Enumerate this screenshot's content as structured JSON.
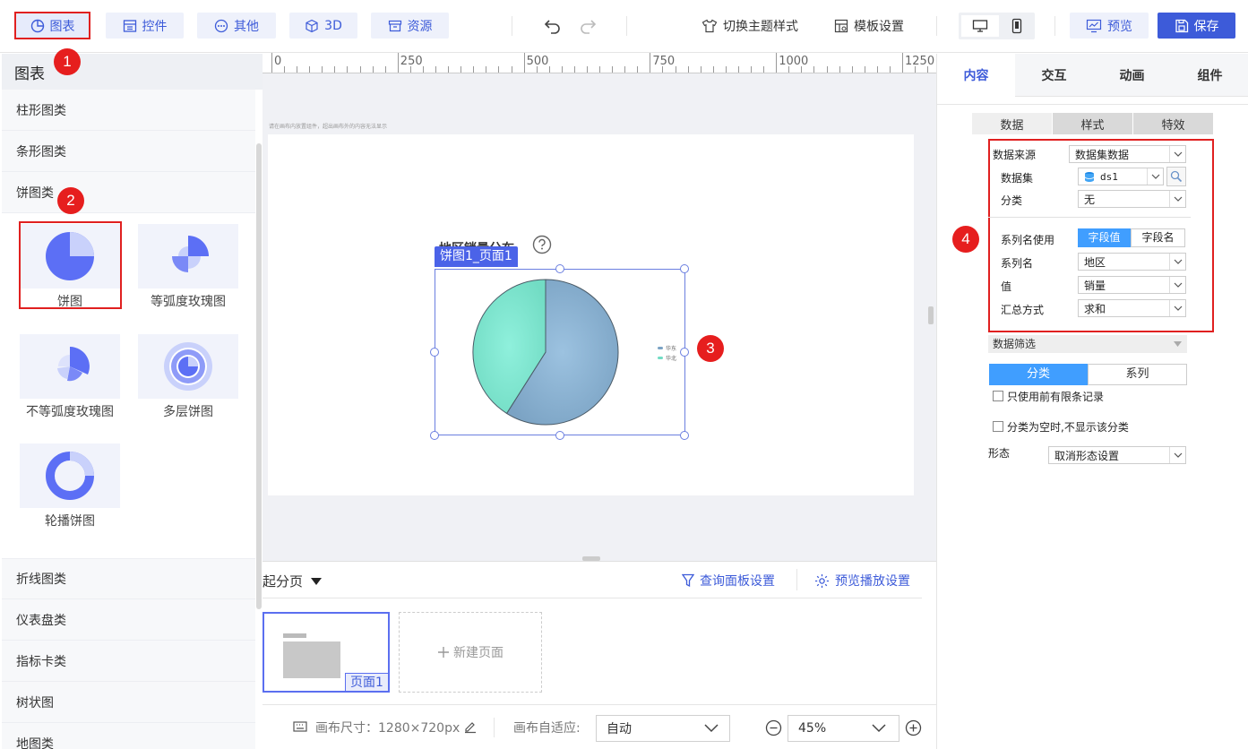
{
  "toolbar": {
    "chart": "图表",
    "widget": "控件",
    "other": "其他",
    "threed": "3D",
    "resource": "资源",
    "switch_theme": "切换主题样式",
    "template_settings": "模板设置",
    "preview": "预览",
    "save": "保存"
  },
  "badges": [
    "1",
    "2",
    "3",
    "4"
  ],
  "left_panel": {
    "title": "图表",
    "categories_top": [
      "柱形图类",
      "条形图类",
      "饼图类"
    ],
    "pie_items": [
      "饼图",
      "等弧度玫瑰图",
      "不等弧度玫瑰图",
      "多层饼图",
      "轮播饼图"
    ],
    "categories_bottom": [
      "折线图类",
      "仪表盘类",
      "指标卡类",
      "树状图",
      "地图类"
    ]
  },
  "ruler": {
    "labels": [
      "0",
      "250",
      "500",
      "750",
      "1000",
      "1250"
    ]
  },
  "canvas": {
    "hint": "请在画布内放置组件，超出画布外的内容无法显示",
    "chart_title": "地区销量分布",
    "widget_tag": "饼图1_页面1",
    "legend": [
      "华东",
      "华北"
    ]
  },
  "chart_data": {
    "type": "pie",
    "categories": [
      "华东",
      "华北"
    ],
    "values": [
      59,
      41
    ],
    "title": "地区销量分布",
    "colors": [
      "#7ba3c4",
      "#72dcc4"
    ]
  },
  "page_bar": {
    "pages_label": "起分页",
    "query_panel": "查询面板设置",
    "preview_play": "预览播放设置",
    "page_name": "页面1",
    "new_page": "新建页面"
  },
  "status_bar": {
    "canvas_size": "画布尺寸：1280×720px",
    "canvas_fit_label": "画布自适应:",
    "canvas_fit_value": "自动",
    "zoom": "45%"
  },
  "right_panel": {
    "tabs": [
      "内容",
      "交互",
      "动画",
      "组件"
    ],
    "sub_tabs": [
      "数据",
      "样式",
      "特效"
    ],
    "data_source_label": "数据来源",
    "data_source_value": "数据集数据",
    "dataset_label": "数据集",
    "dataset_value": "ds1",
    "category_label": "分类",
    "category_value": "无",
    "series_name_use_label": "系列名使用",
    "series_opt_value": "字段值",
    "series_opt_name": "字段名",
    "series_name_label": "系列名",
    "series_name_value": "地区",
    "value_label": "值",
    "value_value": "销量",
    "agg_label": "汇总方式",
    "agg_value": "求和",
    "data_filter": "数据筛选",
    "filter_tab_category": "分类",
    "filter_tab_series": "系列",
    "only_top_n": "只使用前有限条记录",
    "hide_empty": "分类为空时,不显示该分类",
    "form_label": "形态",
    "form_value": "取消形态设置"
  },
  "colors": {
    "accent": "#3d5bd9",
    "accent_light": "#eef1fb",
    "highlight": "#e02020",
    "selected_tab": "#409eff"
  }
}
